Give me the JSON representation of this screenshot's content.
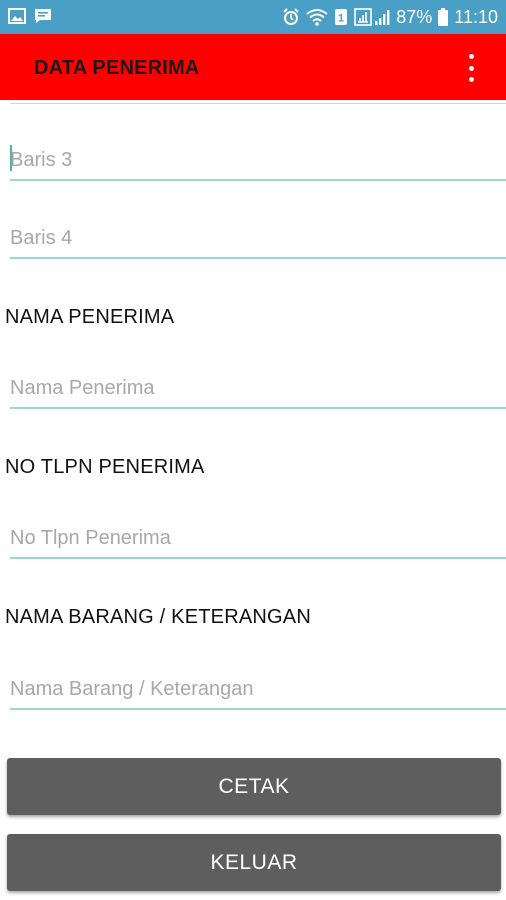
{
  "status_bar": {
    "battery_percent": "87%",
    "time": "11:10",
    "icons": [
      "gallery-icon",
      "message-icon",
      "alarm-icon",
      "wifi-icon",
      "data-icon",
      "signal-icon",
      "battery-icon"
    ]
  },
  "app_bar": {
    "title": "DATA PENERIMA",
    "menu_icon": "overflow-menu-icon",
    "color": "#ff0000"
  },
  "form": {
    "baris3_placeholder": "Baris 3",
    "baris4_placeholder": "Baris 4",
    "nama_label": "NAMA PENERIMA",
    "nama_placeholder": "Nama Penerima",
    "tlpn_label": "NO TLPN PENERIMA",
    "tlpn_placeholder": "No Tlpn Penerima",
    "barang_label": "NAMA BARANG / KETERANGAN",
    "barang_placeholder": "Nama Barang / Keterangan"
  },
  "actions": {
    "cetak_label": "CETAK",
    "keluar_label": "KELUAR"
  }
}
